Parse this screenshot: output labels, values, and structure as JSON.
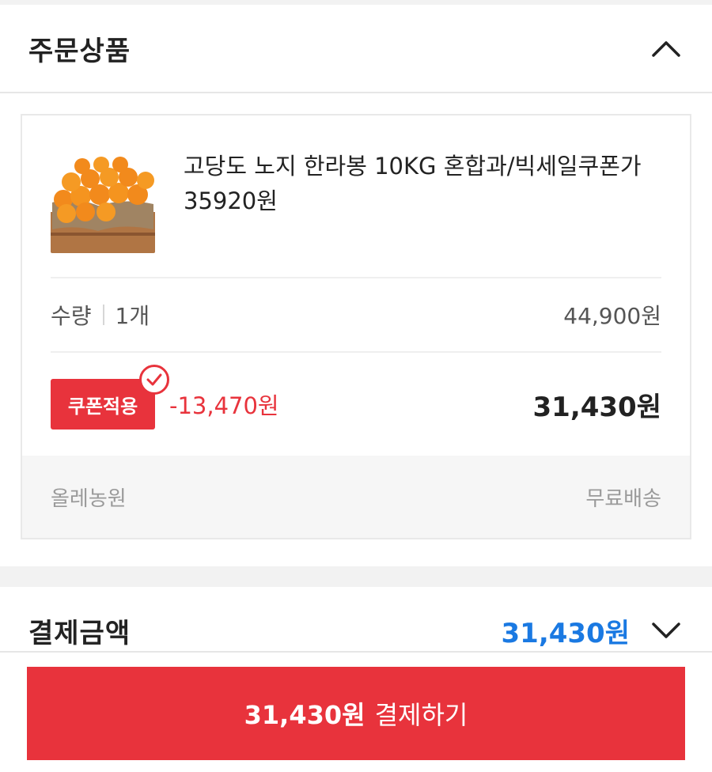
{
  "order_section": {
    "title": "주문상품"
  },
  "product": {
    "image_icon": "orange-fruit-thumbnail",
    "name": "고당도 노지 한라봉 10KG 혼합과/빅세일쿠폰가 35920원",
    "quantity_label": "수량",
    "quantity_value": "1개",
    "original_price": "44,900원",
    "coupon_label": "쿠폰적용",
    "discount": "-13,470원",
    "final_price": "31,430원",
    "seller": "올레농원",
    "shipping": "무료배송"
  },
  "payment_section": {
    "title": "결제금액",
    "total": "31,430원"
  },
  "pay_button": {
    "amount": "31,430원",
    "label": "결제하기"
  },
  "colors": {
    "accent_red": "#e8333c",
    "accent_blue": "#1a79e2"
  }
}
